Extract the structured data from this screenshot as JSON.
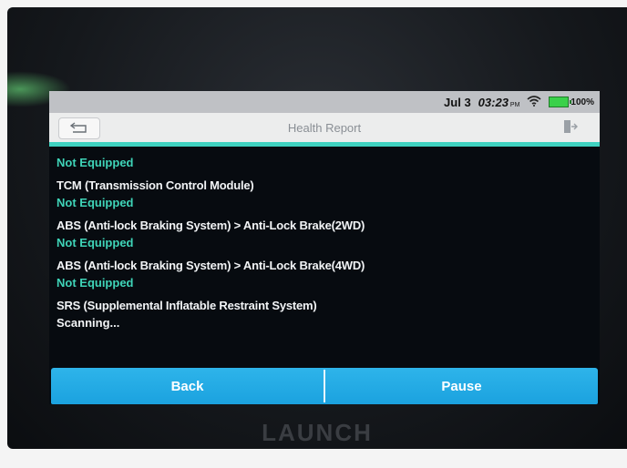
{
  "status_bar": {
    "date": "Jul 3",
    "time": "03:23",
    "ampm": "PM",
    "battery": "100%"
  },
  "header": {
    "title": "Health Report"
  },
  "items": [
    {
      "name": "",
      "status": "Not Equipped"
    },
    {
      "name": "TCM (Transmission Control Module)",
      "status": "Not Equipped"
    },
    {
      "name": "ABS (Anti-lock Braking System) > Anti-Lock Brake(2WD)",
      "status": "Not Equipped"
    },
    {
      "name": "ABS (Anti-lock Braking System) > Anti-Lock Brake(4WD)",
      "status": "Not Equipped"
    },
    {
      "name": "SRS (Supplemental Inflatable Restraint System)",
      "status": "Scanning..."
    }
  ],
  "buttons": {
    "back": "Back",
    "pause": "Pause"
  },
  "device_brand": "LAUNCH"
}
